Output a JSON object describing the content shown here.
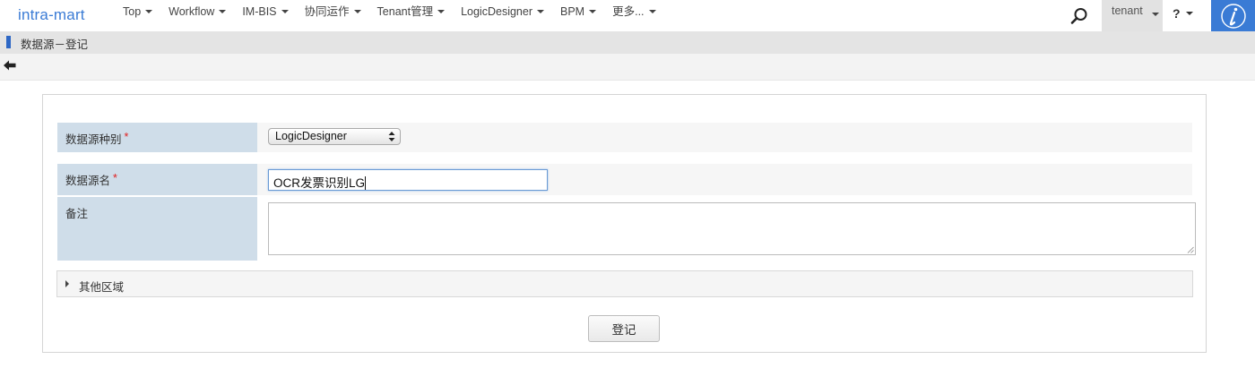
{
  "app": {
    "logo": "intra-mart"
  },
  "nav": {
    "items": [
      {
        "label": "Top"
      },
      {
        "label": "Workflow"
      },
      {
        "label": "IM-BIS"
      },
      {
        "label": "协同运作"
      },
      {
        "label": "Tenant管理"
      },
      {
        "label": "LogicDesigner"
      },
      {
        "label": "BPM"
      },
      {
        "label": "更多..."
      }
    ],
    "search_icon": "search-icon",
    "user_label": "tenant",
    "help_label": "?",
    "brand_icon": "intra-mart-i-icon",
    "accent_color": "#3a7bd5"
  },
  "page": {
    "title": "数据源－登记",
    "back_icon": "arrow-left-icon"
  },
  "form": {
    "type_label": "数据源种别",
    "type_value": "LogicDesigner",
    "name_label": "数据源名",
    "name_value": "OCR发票识别LG",
    "note_label": "备注",
    "note_value": "",
    "required_mark": "*",
    "other_section_label": "其他区域",
    "submit_label": "登记"
  }
}
